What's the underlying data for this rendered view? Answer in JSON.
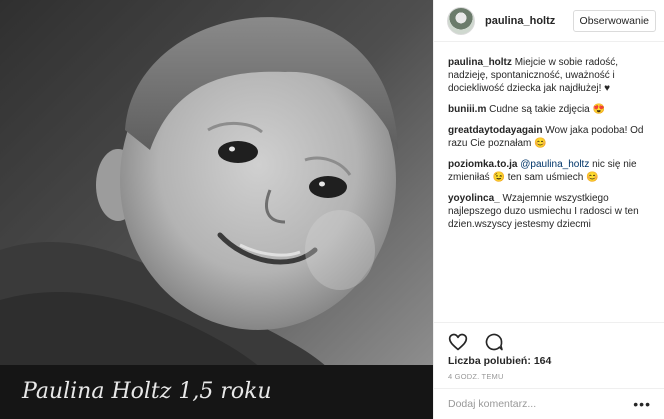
{
  "post": {
    "photo_caption_handwriting": "Paulina Holtz 1,5 roku",
    "image_subject": "baby-photo"
  },
  "header": {
    "username": "paulina_holtz",
    "follow_label": "Obserwowanie"
  },
  "comments": [
    {
      "user": "paulina_holtz",
      "mention": "",
      "text": "Miejcie w sobie radość, nadzieję, spontaniczność, uważność i dociekliwość dziecka jak najdłużej! ♥"
    },
    {
      "user": "buniii.m",
      "mention": "",
      "text": "Cudne są takie zdjęcia 😍"
    },
    {
      "user": "greatdaytodayagain",
      "mention": "",
      "text": "Wow jaka podoba! Od razu Cie poznałam 😊"
    },
    {
      "user": "poziomka.to.ja",
      "mention": "@paulina_holtz",
      "text": "nic się nie zmieniłaś 😉 ten sam uśmiech 😊"
    },
    {
      "user": "yoyolinca_",
      "mention": "",
      "text": "Wzajemnie wszystkiego najlepszego duzo usmiechu I radosci w ten dzien.wszyscy jestesmy dziecmi"
    }
  ],
  "likes": {
    "label": "Liczba polubień:",
    "count": "164"
  },
  "time": "4 GODZ. TEMU",
  "add_comment": {
    "placeholder": "Dodaj komentarz...",
    "more_label": "•••"
  },
  "icons": {
    "like": "heart-icon",
    "comment": "comment-icon",
    "more": "more-options-icon"
  }
}
